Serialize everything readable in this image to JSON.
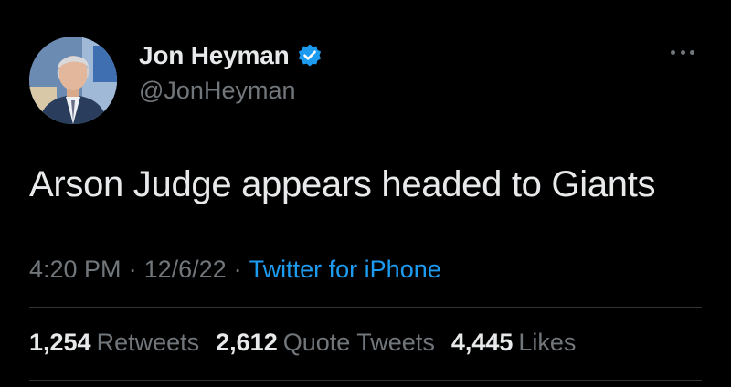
{
  "author": {
    "display_name": "Jon Heyman",
    "handle": "@JonHeyman",
    "verified_icon": "verified-badge-icon",
    "avatar_icon": "profile-photo"
  },
  "more_icon": "more-options-icon",
  "tweet": {
    "text": "Arson Judge appears headed to Giants"
  },
  "meta": {
    "time": "4:20 PM",
    "separator": "·",
    "date": "12/6/22",
    "source": "Twitter for iPhone"
  },
  "stats": {
    "retweets_count": "1,254",
    "retweets_label": "Retweets",
    "quotes_count": "2,612",
    "quotes_label": "Quote Tweets",
    "likes_count": "4,445",
    "likes_label": "Likes"
  },
  "colors": {
    "background": "#000000",
    "primary_text": "#e7e9ea",
    "secondary_text": "#71767b",
    "accent": "#1d9bf0",
    "divider": "#2f3336"
  }
}
